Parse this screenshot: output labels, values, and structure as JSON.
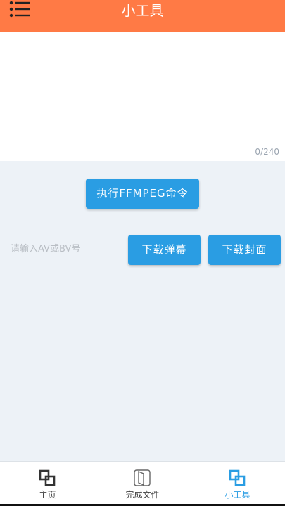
{
  "app_bar": {
    "title": "小工具",
    "menu_icon": "menu-list-icon",
    "background_color": "#ff7a45"
  },
  "command_input": {
    "value": "",
    "counter": "0/240"
  },
  "actions": {
    "exec_ffmpeg_label": "执行FFMPEG命令",
    "download_danmaku_label": "下载弹幕",
    "download_cover_label": "下载封面"
  },
  "video_id_input": {
    "value": "",
    "placeholder": "请输入AV或BV号"
  },
  "bottom_nav": {
    "accent_color": "#2a9de3",
    "items": [
      {
        "label": "主页",
        "icon": "home-icon",
        "active": false
      },
      {
        "label": "完成文件",
        "icon": "book-icon",
        "active": false
      },
      {
        "label": "小工具",
        "icon": "tools-icon",
        "active": true
      }
    ]
  }
}
